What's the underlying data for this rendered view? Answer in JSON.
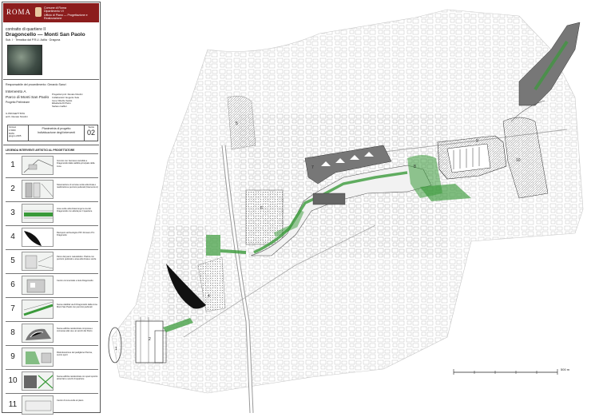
{
  "header": {
    "logo": "ROMA",
    "org_lines": [
      "Comune di Roma",
      "Dipartimento VI",
      "Ufficio di Piano — Progettazione e Realizzazione"
    ]
  },
  "title": {
    "contract": "contratto di quartiere II",
    "district": "Dragoncello — Monti San Paolo",
    "subtitle": "Sub. I · Tematica dal P.R.U. Acilia · Dragona"
  },
  "responsible": "Responsabile del procedimento: Gerardo Sanzi",
  "intervention": {
    "label": "Intervento A",
    "park": "Parco di Monti San Paolo",
    "phase": "Progetto Preliminare",
    "credits": [
      "Progettisti prof. Renato Nicolini",
      "Collaboratori: Eugenio Sole",
      "Irene Villa De Santis",
      "Elisabetta Di Pietro",
      "Stefano Gaffuri"
    ]
  },
  "rilievo": [
    "IL PROGETTISTA",
    "arch. Renato Nicolini"
  ],
  "table": {
    "left": [
      "SCALA",
      "1:5000",
      "DATA",
      "giugno 2005"
    ],
    "center": [
      "Planimetria di progetto",
      "Individuazione degli interventi"
    ],
    "tavola_label": "Tavola",
    "tavola_num": "02"
  },
  "legend_title": "LEGENDA  INTERVENTI  ARTISTICI AL PROGETTATORE",
  "legend": [
    {
      "num": "1",
      "text": "Incrocio con l'accesso carrabile a Dragoncello dalla viabilità principale della zona"
    },
    {
      "num": "2",
      "text": "Sistemazione di un'area verde attrezzata e realizzazione percorsi pedonali (Intervento A)"
    },
    {
      "num": "3",
      "text": "Area verde attrezzata lungo la via del Dragoncello con attività per il quartiere"
    },
    {
      "num": "4",
      "text": "Recupero archeologico P.B. Romano P.U. Dragonetto"
    },
    {
      "num": "5",
      "text": "Parco del parco naturalistico. Piazza con percorsi pedonali e area attrezzata a verde"
    },
    {
      "num": "6",
      "text": "Centro commerciale e Aula Dragoncello"
    },
    {
      "num": "7",
      "text": "Nuova viabilità via di Dragoncello dalla zona Monti San Paolo con percorsi pedonali"
    },
    {
      "num": "8",
      "text": "Nuova edilizia residenziale compresa e connessa alla via e ai servizi del Parco"
    },
    {
      "num": "9",
      "text": "Ristrutturazione del padiglione Piscina, centro sport"
    },
    {
      "num": "10",
      "text": "Nuova edilizia residenziale con spazi sportivi attrezzati e servizi di quartiere"
    },
    {
      "num": "11",
      "text": "Centro di cura verde al piano"
    }
  ],
  "map": {
    "labels": [
      "1",
      "2",
      "4",
      "5",
      "6",
      "7",
      "8",
      "9",
      "10"
    ],
    "scale_label": "500 m"
  },
  "colors": {
    "header_red": "#8c1d1d",
    "park_green": "#3a9a3a",
    "building_gray": "#8a8a8a",
    "archaeology_black": "#111111"
  }
}
